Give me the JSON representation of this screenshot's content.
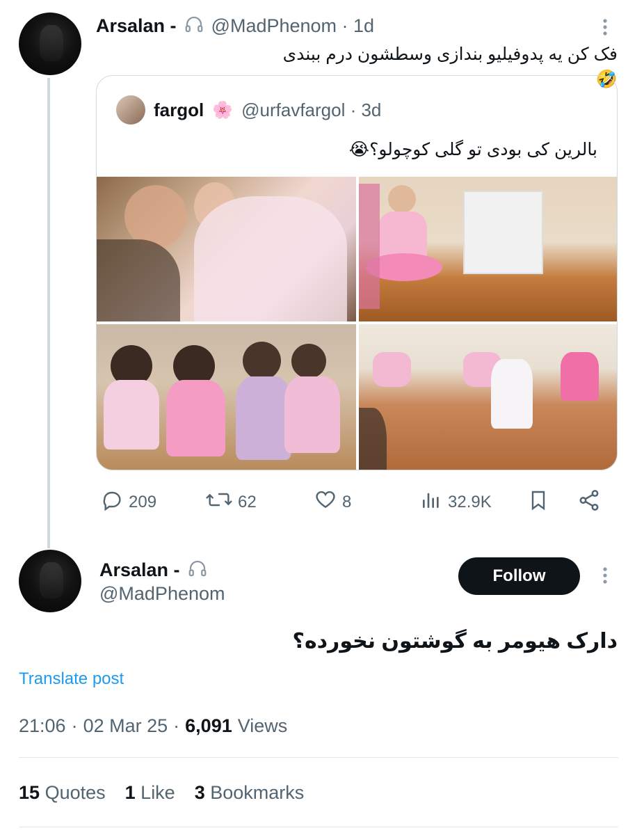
{
  "quoting_tweet": {
    "author_name": "Arsalan -",
    "handle_time": "@MadPhenom · 1d",
    "text": "فک کن یه پدوفیلیو بندازی وسطشون درم ببندی🤣"
  },
  "quoted_tweet": {
    "author_name": "fargol",
    "flower": "🌸",
    "handle_time": "@urfavfargol · 3d",
    "text": "بالرین کی بودی تو گلی کوچولو؟😭"
  },
  "actions": {
    "replies": "209",
    "reposts": "62",
    "likes": "8",
    "views": "32.9K"
  },
  "reply_tweet": {
    "author_name": "Arsalan -",
    "handle": "@MadPhenom",
    "follow_label": "Follow",
    "text": "دارک هیومر به گوشتون نخورده؟",
    "translate": "Translate post",
    "time": "21:06",
    "date": "02 Mar 25",
    "views_count": "6,091",
    "views_label": "Views"
  },
  "stats": {
    "quotes_count": "15",
    "quotes_label": "Quotes",
    "likes_count": "1",
    "likes_label": "Like",
    "bookmarks_count": "3",
    "bookmarks_label": "Bookmarks"
  },
  "colors": {
    "link": "#1d9bf0",
    "muted": "#536471",
    "line": "#cfd9de"
  }
}
